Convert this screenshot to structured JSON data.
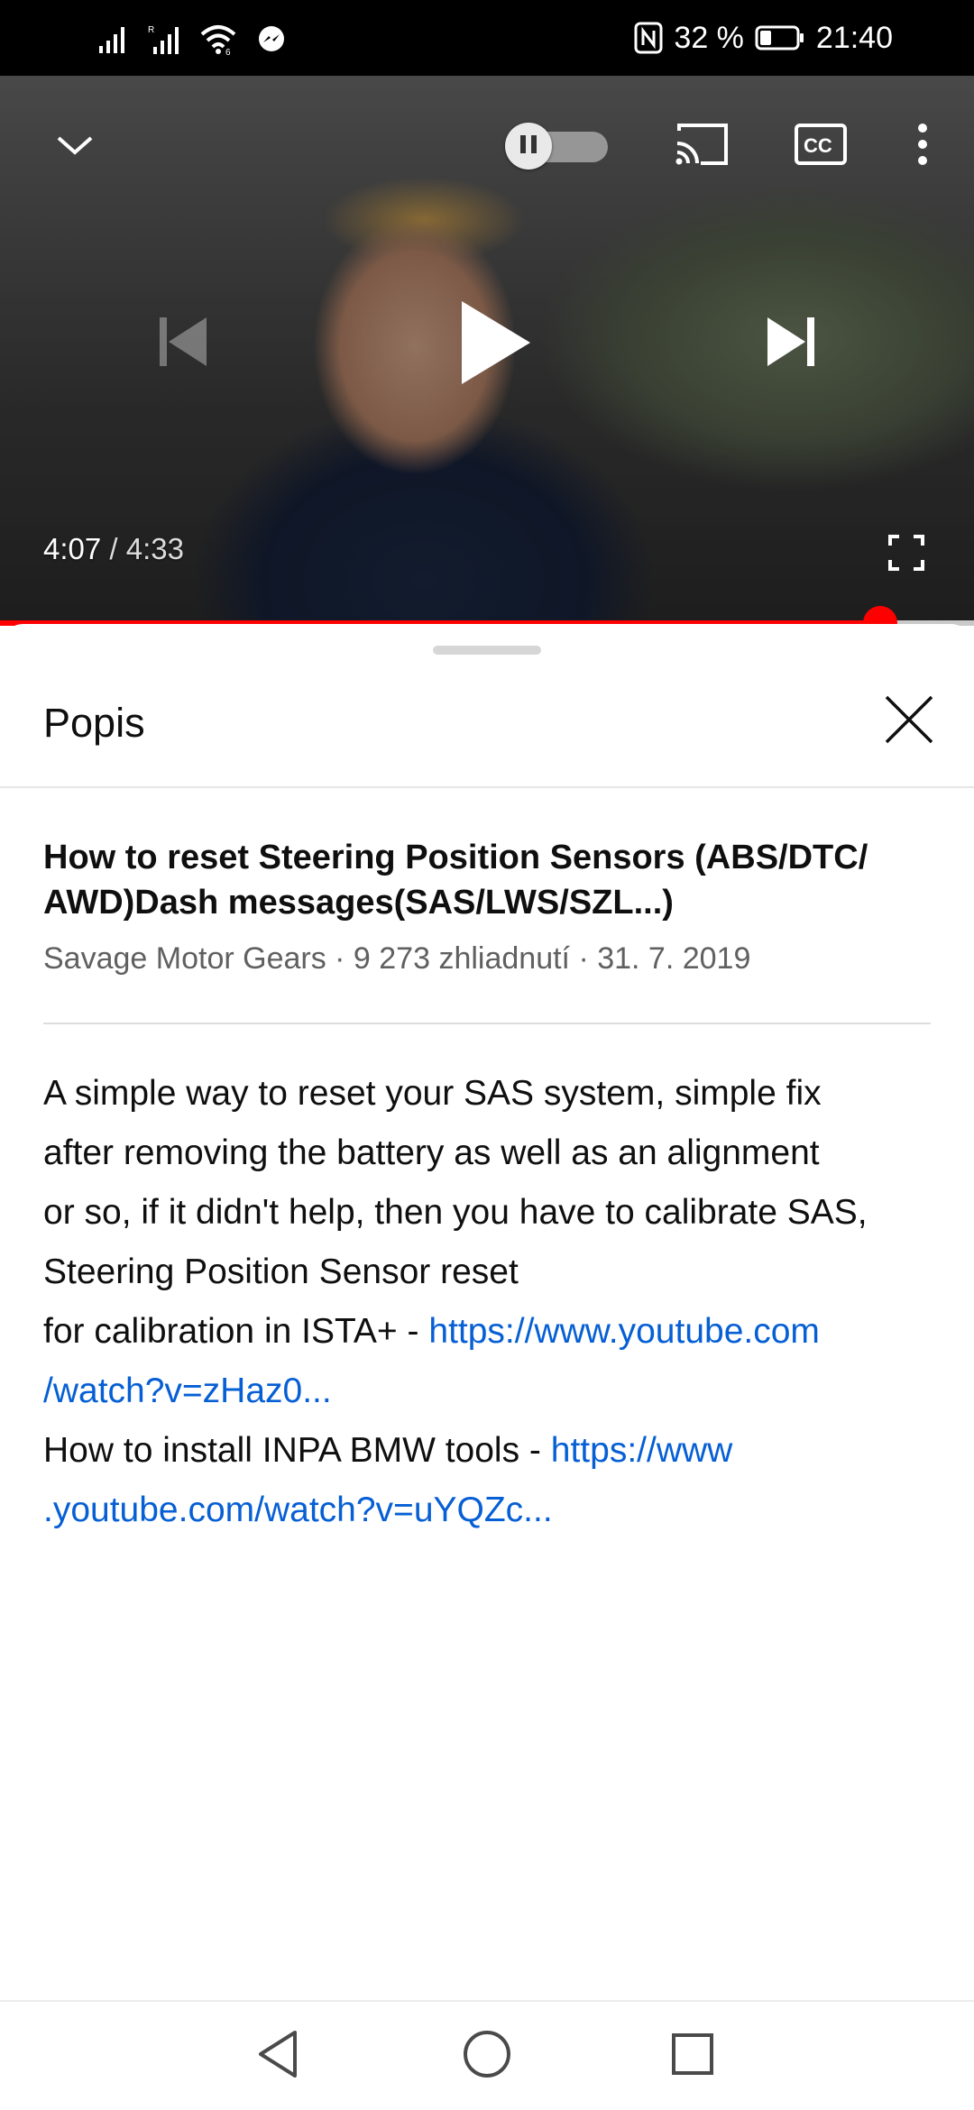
{
  "status_bar": {
    "battery_percent": "32 %",
    "time": "21:40",
    "battery_level": 0.32,
    "icons": [
      "signal-icon",
      "signal-roaming-icon",
      "wifi-icon",
      "messenger-icon",
      "nfc-icon",
      "battery-icon"
    ]
  },
  "player": {
    "current_time": "4:07",
    "separator": " / ",
    "duration": "4:33",
    "progress": 0.904,
    "buffered": 1.0,
    "autoplay": "on",
    "icons": [
      "chevron-down-icon",
      "pause-icon",
      "cast-icon",
      "cc-icon",
      "more-vert-icon",
      "skip-previous-icon",
      "play-icon",
      "skip-next-icon",
      "fullscreen-icon"
    ],
    "colors": {
      "progress": "#ff0000",
      "buffer": "#c9c9c9"
    }
  },
  "sheet": {
    "title": "Popis",
    "close_icon": "close-icon"
  },
  "video": {
    "title": "How to reset Steering Position Sensors (ABS/DTC/ AWD)Dash messages(SAS/LWS/SZL...)",
    "title_line1": "How to reset Steering Position Sensors (ABS/DTC/",
    "title_line2": "AWD)Dash messages(SAS/LWS/SZL...)",
    "channel": "Savage Motor Gears",
    "views": "9 273 zhliadnutí",
    "date": "31. 7. 2019",
    "meta_separator": " · "
  },
  "description": {
    "line1": "A simple way to reset your SAS system, simple fix",
    "line2": "after removing the battery as well as an alignment",
    "line3": "or so, if it didn't help, then you have to calibrate SAS,",
    "line4": "Steering Position Sensor reset",
    "line5_text": "for calibration in ISTA+ - ",
    "link1_part1": "https://www.youtube.com",
    "link1_part2": "/watch?v=zHaz0...",
    "line7_text": "How to install INPA BMW tools - ",
    "link2_part1": "https://www",
    "link2_part2": ".youtube.com/watch?v=uYQZc...",
    "link_color": "#065fd4"
  },
  "nav_bar": {
    "icons": [
      "back-icon",
      "home-icon",
      "recents-icon"
    ]
  }
}
